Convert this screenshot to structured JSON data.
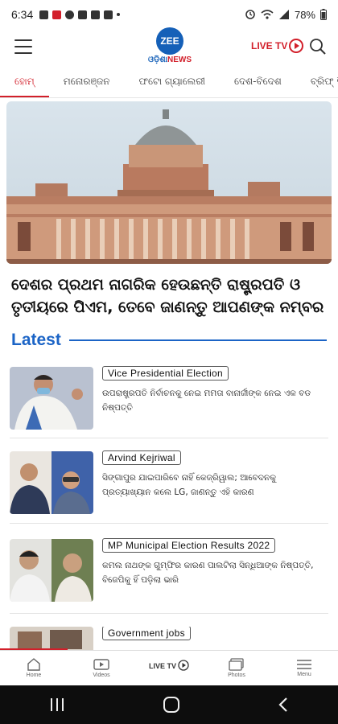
{
  "status_bar": {
    "time": "6:34",
    "battery": "78%"
  },
  "header": {
    "logo_text": "ZEE",
    "logo_sub_a": "ଓଡ଼ିଶା",
    "logo_sub_b": "NEWS",
    "live_tv_label": "LIVE TV"
  },
  "tabs": [
    {
      "label": "ହୋମ୍",
      "active": true
    },
    {
      "label": "ମନୋରଞ୍ଜନ"
    },
    {
      "label": "ଫଟୋ ଗ୍ୟାଲେରୀ"
    },
    {
      "label": "ଦେଶ-ବିଦେଶ"
    },
    {
      "label": "ବ୍ରିଫ୍ ସି"
    }
  ],
  "hero": {
    "title": "ଦେଶର ପ୍ରଥମ ନାଗରିକ ହେଉଛନ୍ତି ରାଷ୍ଟ୍ରପତି ଓ ତୃତୀୟରେ ପିଏମ, ତେବେ ଜାଣନ୍ତୁ ଆପଣଙ୍କ ନମ୍ବର"
  },
  "latest": {
    "heading": "Latest",
    "items": [
      {
        "tag": "Vice Presidential Election",
        "headline": "ଉପରାଷ୍ଟ୍ରପତି ନିର୍ବାଚନକୁ ନେଇ ମମତା ବାନାର୍ଜୀଙ୍କ ନେଇ ଏକ ବଡ ନିଷ୍ପତ୍ତି"
      },
      {
        "tag": "Arvind Kejriwal",
        "headline": "ସିଙ୍ଗାପୁର ଯାଇପାରିବେ ନାହିଁ କେଜ୍ରିୱାଲ; ଆବେଦନକୁ ପ୍ରତ୍ୟାଖ୍ୟାନ କଲେ LG, ଜାଣନ୍ତୁ ଏହି କାରଣ"
      },
      {
        "tag": "MP Municipal Election Results 2022",
        "headline": "କମଲ ନାଥଙ୍କ ଗୁମ୍ଫିର କାରଣ ପାଲଟିଲା ସିନ୍ଧିଆଙ୍କ ନିଷ୍ପତ୍ତି, ବିଜେପିକୁ ହିଁ ପଡ଼ିଲା ଭାରି"
      },
      {
        "tag": "Government jobs",
        "headline": ""
      }
    ]
  },
  "bottom_nav": {
    "home": "Home",
    "videos": "Videos",
    "live_tv": "LIVE TV",
    "photos": "Photos",
    "menu": "Menu"
  }
}
